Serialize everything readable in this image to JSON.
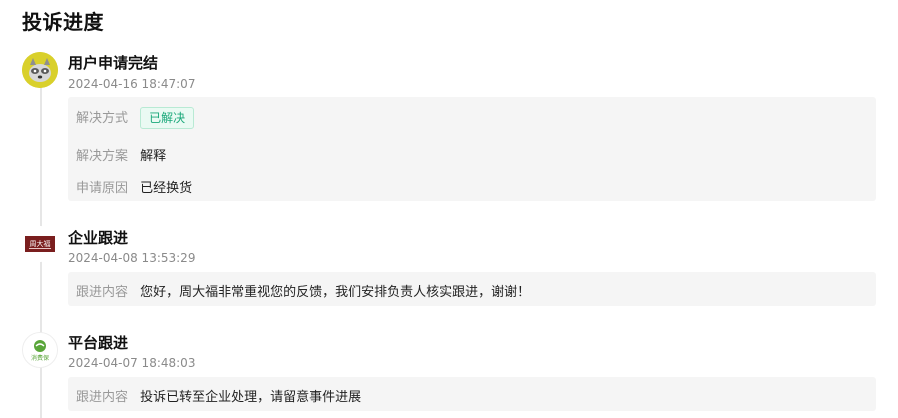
{
  "page": {
    "title": "投诉进度"
  },
  "entries": [
    {
      "title": "用户申请完结",
      "time": "2024-04-16 18:47:07",
      "avatar_icon": "raccoon-avatar-icon",
      "details": {
        "method_label": "解决方式",
        "method_value": "已解决",
        "plan_label": "解决方案",
        "plan_value": "解释",
        "reason_label": "申请原因",
        "reason_value": "已经换货"
      }
    },
    {
      "title": "企业跟进",
      "time": "2024-04-08 13:53:29",
      "avatar_icon": "company-logo-icon",
      "logo_text": "周大福",
      "details": {
        "content_label": "跟进内容",
        "content_value": "您好，周大福非常重视您的反馈，我们安排负责人核实跟进，谢谢！"
      }
    },
    {
      "title": "平台跟进",
      "time": "2024-04-07 18:48:03",
      "avatar_icon": "platform-logo-icon",
      "logo_text": "消费保",
      "details": {
        "content_label": "跟进内容",
        "content_value": "投诉已转至企业处理，请留意事件进展"
      }
    }
  ],
  "colors": {
    "badge_text": "#1aa87a",
    "badge_bg": "#eafaf3",
    "company_logo_bg": "#7a1e1e",
    "platform_logo_green": "#5aa63a"
  }
}
